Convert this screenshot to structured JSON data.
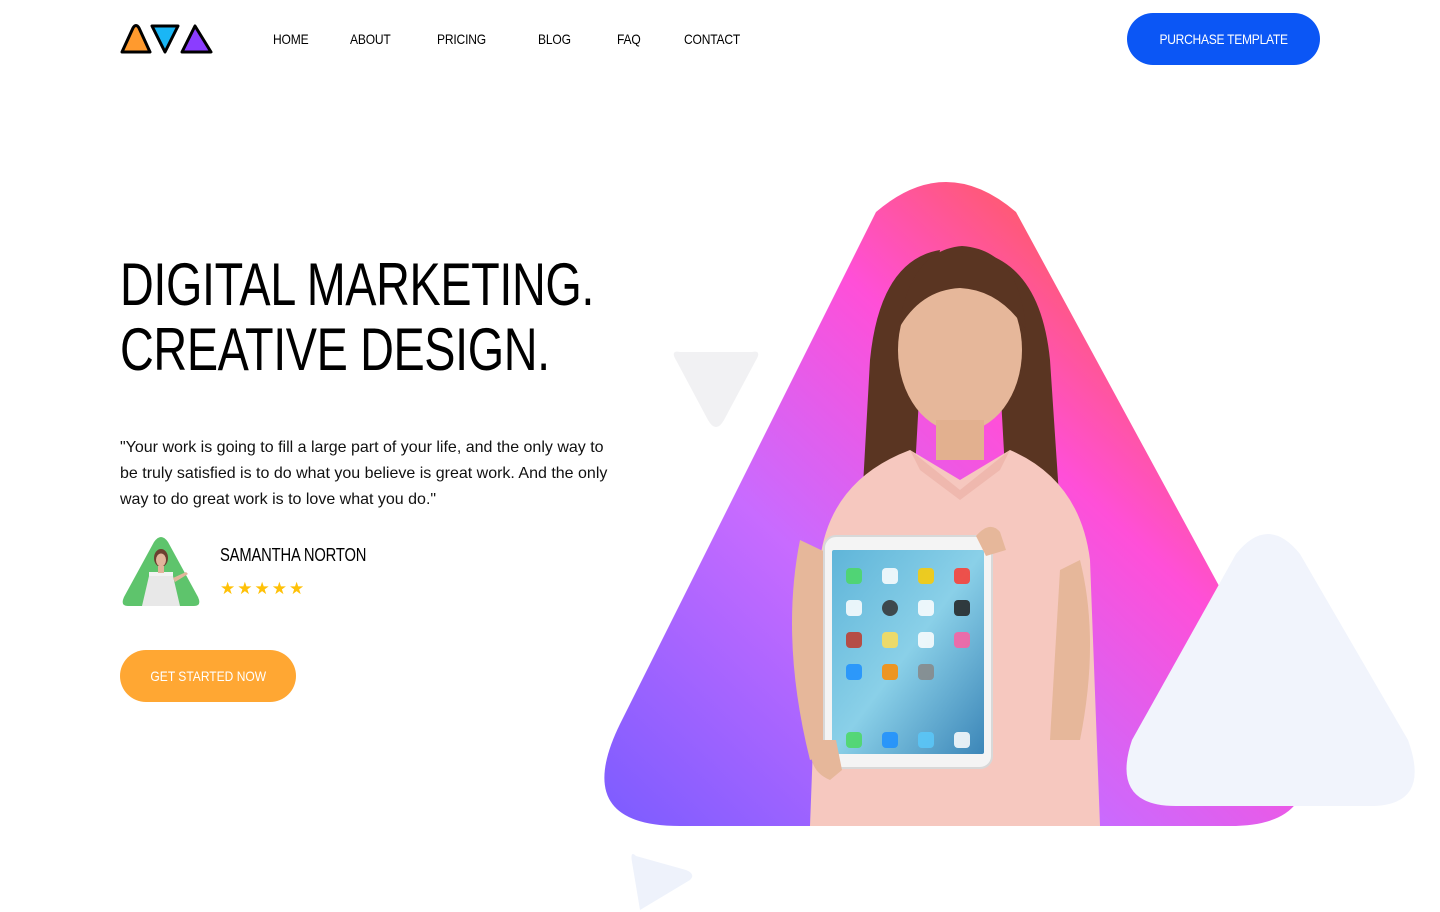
{
  "header": {
    "nav": [
      "HOME",
      "ABOUT",
      "PRICING",
      "BLOG",
      "FAQ",
      "CONTACT"
    ],
    "purchase_label": "PURCHASE TEMPLATE"
  },
  "hero": {
    "headline_line1": "DIGITAL MARKETING.",
    "headline_line2": "CREATIVE DESIGN.",
    "quote": "\"Your work is going to fill a large part of your life, and the only way to be truly satisfied is to do what you believe is great work. And the only way to do great work is to love what you do.\"",
    "author_name": "SAMANTHA NORTON",
    "rating": 5,
    "cta_label": "GET STARTED NOW"
  },
  "colors": {
    "primary_blue": "#0b56f5",
    "cta_orange": "#ffa733",
    "star_yellow": "#ffc107",
    "avatar_green": "#5ec46c"
  },
  "icons": {
    "logo": "triangle-logo",
    "star": "star-icon"
  }
}
